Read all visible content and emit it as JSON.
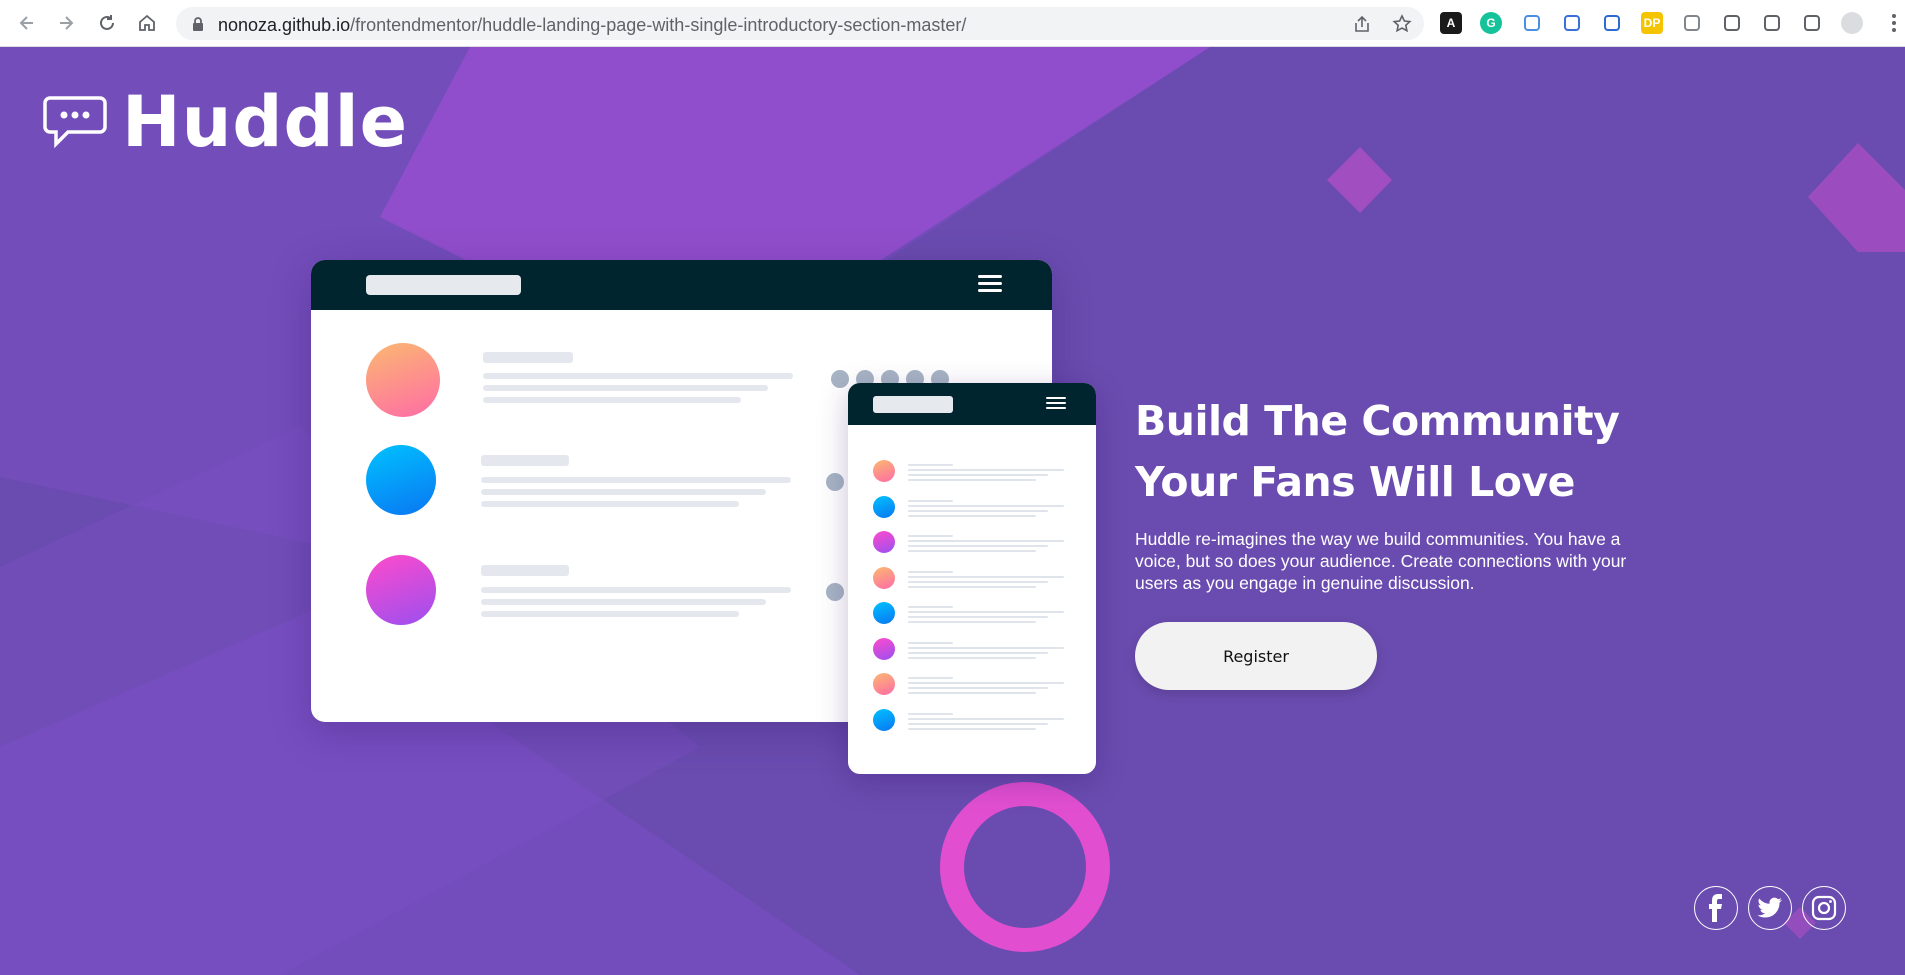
{
  "browser": {
    "url_host": "nonoza.github.io",
    "url_path": "/frontendmentor/huddle-landing-page-with-single-introductory-section-master/",
    "extensions": [
      {
        "name": "adobe-acrobat-icon",
        "label": "A",
        "color": "#1a1a1a"
      },
      {
        "name": "grammarly-icon",
        "label": "G",
        "color": "#15c39a"
      },
      {
        "name": "extension-blue-icon",
        "label": "",
        "color": "#4a90e2"
      },
      {
        "name": "screen-recorder-icon",
        "label": "",
        "color": "#3b6fd8"
      },
      {
        "name": "mobile-viewer-icon",
        "label": "",
        "color": "#2c6bd0"
      },
      {
        "name": "dp-icon",
        "label": "DP",
        "color": "#f5c400"
      },
      {
        "name": "camera-icon",
        "label": "",
        "color": "#80868b"
      },
      {
        "name": "extensions-puzzle-icon",
        "label": "",
        "color": "#5f6368"
      },
      {
        "name": "media-controls-icon",
        "label": "",
        "color": "#5f6368"
      },
      {
        "name": "side-panel-icon",
        "label": "",
        "color": "#5f6368"
      },
      {
        "name": "profile-avatar-icon",
        "label": "",
        "color": "#5f6368"
      },
      {
        "name": "menu-kebab-icon",
        "label": "",
        "color": "#5f6368"
      }
    ]
  },
  "brand": {
    "name": "Huddle"
  },
  "hero": {
    "headline": "Build The Community Your Fans Will Love",
    "description": "Huddle re-imagines the way we build communities. You have a voice, but so does your audience. Create connections with your users as you engage in genuine discussion.",
    "cta_label": "Register"
  },
  "social": [
    {
      "name": "facebook-icon"
    },
    {
      "name": "twitter-icon"
    },
    {
      "name": "instagram-icon"
    }
  ],
  "colors": {
    "background": "#6a4cb0",
    "mockup_bar": "#00252e",
    "gradient_orange": [
      "#fbb870",
      "#ff6ca6"
    ],
    "gradient_blue": [
      "#00c2ff",
      "#0a76f2"
    ],
    "gradient_pink": [
      "#ff4bcb",
      "#9b4ff0"
    ]
  }
}
